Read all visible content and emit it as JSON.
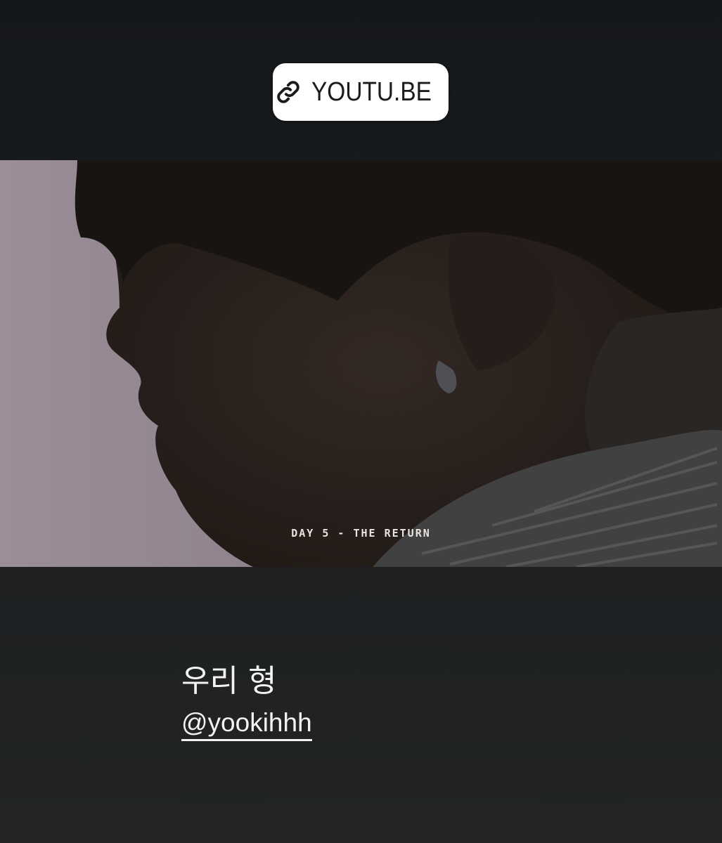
{
  "link_sticker": {
    "icon": "link-icon",
    "label": "YOUTU.BE"
  },
  "video": {
    "caption": "DAY 5 - THE RETURN"
  },
  "story_text": {
    "line1": "우리 형",
    "mention": "@yookihhh"
  },
  "colors": {
    "background": "#1a1d20",
    "sticker_bg": "#ffffff",
    "text": "#f2f2f2"
  }
}
